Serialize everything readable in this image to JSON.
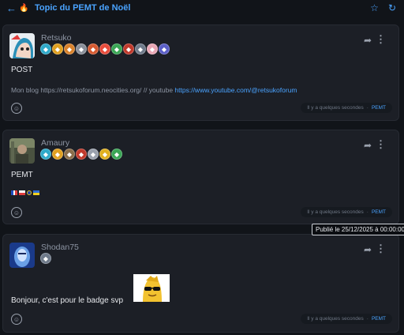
{
  "topbar": {
    "back_icon": "arrow-left-icon",
    "flame_icon": "flame-icon",
    "title": "Topic du PEMT de Noël",
    "star_icon": "star-icon",
    "refresh_icon": "refresh-icon"
  },
  "posts": [
    {
      "author": "Retsuko",
      "title": "POST",
      "body_prefix": "Mon blog https://retsukoforum.neocities.org/ // youtube ",
      "body_link": "https://www.youtube.com/@retsukoforum",
      "time": "Il y a quelques secondes",
      "tag": "PEMT",
      "badge_colors": [
        "#2fa9c9",
        "#e0a020",
        "#d9822b",
        "#8a8f99",
        "#d65a31",
        "#e74c3c",
        "#3aa655",
        "#c0392b",
        "#6f7a8a",
        "#e9a6b4",
        "#5b5fc7"
      ]
    },
    {
      "author": "Amaury",
      "title": "PEMT",
      "time": "Il y a quelques secondes",
      "tag": "PEMT",
      "flags": [
        "fr",
        "pl",
        "eu",
        "ua"
      ],
      "badge_colors": [
        "#2fa9c9",
        "#e0a020",
        "#8a6d4a",
        "#c0392b",
        "#9aa1ad",
        "#e0b020",
        "#3aa655"
      ]
    },
    {
      "author": "Shodan75",
      "title": "Bonjour, c'est pour le badge svp",
      "time": "Il y a quelques secondes",
      "tag": "PEMT",
      "badge_colors": [
        "#6f7a8a"
      ]
    }
  ],
  "tooltip": "Publié le 25/12/2025 à 00:00:00",
  "colors": {
    "accent": "#4aa3ff",
    "background": "#111419",
    "card": "#1c1f26"
  }
}
